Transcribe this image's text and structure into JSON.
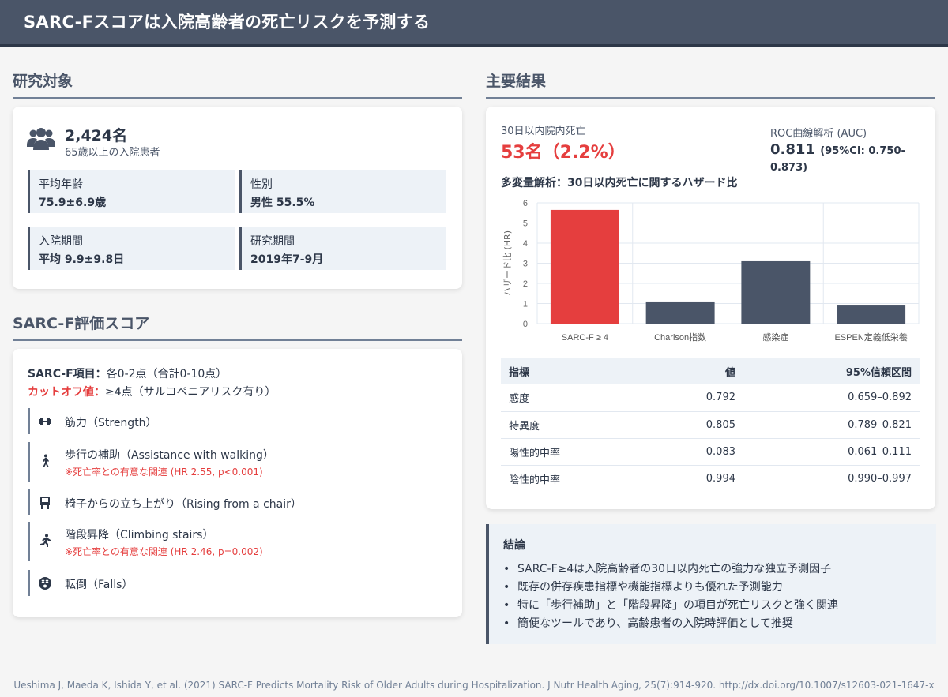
{
  "header": {
    "title": "SARC-Fスコアは入院高齢者の死亡リスクを予測する"
  },
  "study": {
    "section_title": "研究対象",
    "count": "2,424名",
    "count_sub": "65歳以上の入院患者",
    "stats": [
      {
        "label": "平均年齢",
        "value": "75.9±6.9歳"
      },
      {
        "label": "性別",
        "value": "男性 55.5%"
      },
      {
        "label": "入院期間",
        "value": "平均 9.9±9.8日"
      },
      {
        "label": "研究期間",
        "value": "2019年7-9月"
      }
    ]
  },
  "sarcf": {
    "section_title": "SARC-F評価スコア",
    "items_label": "SARC-F項目：",
    "items_text": "各0-2点（合計0-10点）",
    "cutoff_label": "カットオフ値：",
    "cutoff_text": "≥4点（サルコペニアリスク有り）",
    "items": [
      {
        "icon": "dumbbell-icon",
        "text": "筋力（Strength）",
        "note": ""
      },
      {
        "icon": "walking-icon",
        "text": "歩行の補助（Assistance with walking）",
        "note": "※死亡率との有意な関連 (HR 2.55, p<0.001)"
      },
      {
        "icon": "chair-icon",
        "text": "椅子からの立ち上がり（Rising from a chair）",
        "note": ""
      },
      {
        "icon": "stairs-icon",
        "text": "階段昇降（Climbing stairs）",
        "note": "※死亡率との有意な関連 (HR 2.46, p=0.002)"
      },
      {
        "icon": "falls-icon",
        "text": "転倒（Falls）",
        "note": ""
      }
    ]
  },
  "results": {
    "section_title": "主要結果",
    "death_label": "30日以内院内死亡",
    "death_value": "53名（2.2%）",
    "roc_label": "ROC曲線解析 (AUC)",
    "auc_value": "0.811",
    "auc_ci": "(95%CI: 0.750-0.873)",
    "hr_title": "多変量解析：30日以内死亡に関するハザード比",
    "table": {
      "headers": [
        "指標",
        "値",
        "95%信頼区間"
      ],
      "rows": [
        [
          "感度",
          "0.792",
          "0.659–0.892"
        ],
        [
          "特異度",
          "0.805",
          "0.789–0.821"
        ],
        [
          "陽性的中率",
          "0.083",
          "0.061–0.111"
        ],
        [
          "陰性的中率",
          "0.994",
          "0.990–0.997"
        ]
      ]
    }
  },
  "chart_data": {
    "type": "bar",
    "categories": [
      "SARC-F ≥ 4",
      "Charlson指数",
      "感染症",
      "ESPEN定義低栄養"
    ],
    "values": [
      5.65,
      1.1,
      3.1,
      0.9
    ],
    "ylabel": "ハザード比 (HR)",
    "xlabel": "",
    "ylim": [
      0,
      6
    ],
    "yticks": [
      0,
      1,
      2,
      3,
      4,
      5,
      6
    ],
    "colors": [
      "#e53e3e",
      "#4a5568",
      "#4a5568",
      "#4a5568"
    ],
    "grid": true
  },
  "conclusion": {
    "title": "結論",
    "points": [
      "SARC-F≥4は入院高齢者の30日以内死亡の強力な独立予測因子",
      "既存の併存疾患指標や機能指標よりも優れた予測能力",
      "特に「歩行補助」と「階段昇降」の項目が死亡リスクと強く関連",
      "簡便なツールであり、高齢患者の入院時評価として推奨"
    ]
  },
  "footer": {
    "citation": "Ueshima J, Maeda K, Ishida Y, et al. (2021) SARC-F Predicts Mortality Risk of Older Adults during Hospitalization. J Nutr Health Aging, 25(7):914-920. http://dx.doi.org/10.1007/s12603-021-1647-x"
  }
}
